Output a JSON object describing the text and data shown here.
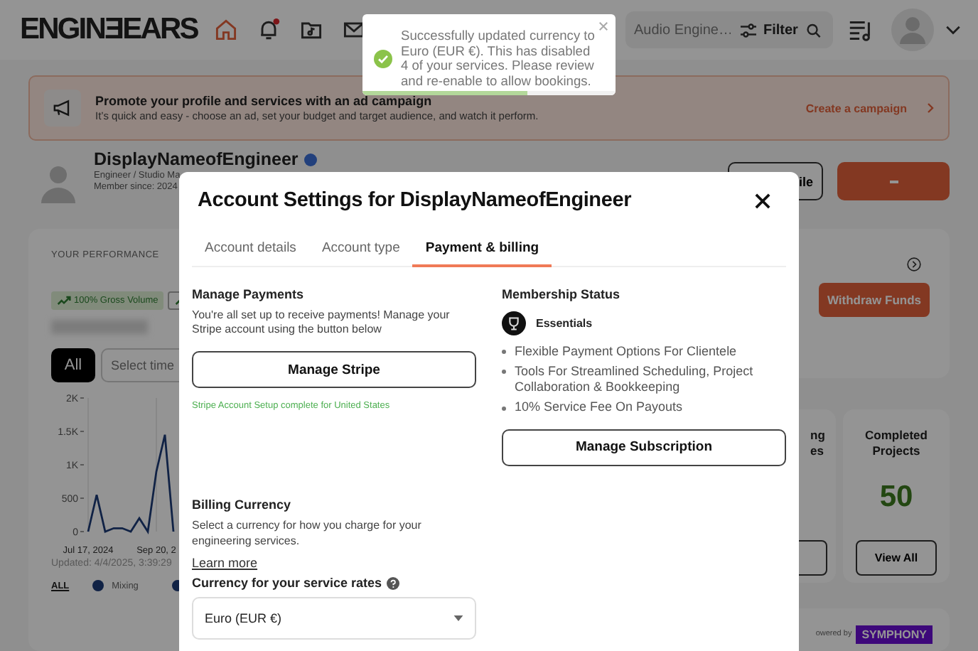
{
  "header": {
    "logo": "ENGINƎEARS",
    "nav": [
      {
        "kind": "home",
        "selected": true,
        "dot": false
      },
      {
        "kind": "bell",
        "selected": false,
        "dot": true
      },
      {
        "kind": "folder",
        "selected": false,
        "dot": false
      },
      {
        "kind": "mail",
        "selected": false,
        "dot": false
      }
    ],
    "search": {
      "placeholder": "Audio Engine…"
    },
    "filter": "Filter"
  },
  "promo": {
    "title": "Promote your profile and services with an ad campaign",
    "text": "It’s quick and easy - choose an ad, set your budget and target audience, and watch it perform.",
    "link": "Create a campaign"
  },
  "profile": {
    "name": "DisplayNameofEngineer",
    "verified": true,
    "role": "Engineer / Studio Ma",
    "member": "Member since: 2024",
    "edit_button": "ile"
  },
  "performance": {
    "heading": "YOUR PERFORMANCE",
    "badge": "100% Gross Volume",
    "all": "All",
    "select": "Select time",
    "chart_data": {
      "type": "line",
      "categories": [
        "Jul 17, 2024",
        null,
        null,
        null,
        null,
        null,
        null,
        null,
        "Sep 20, 2",
        null,
        null
      ],
      "series": [
        {
          "color": "#1d3b78",
          "values": [
            0,
            550,
            0,
            50,
            50,
            0,
            200,
            0,
            900,
            1450,
            0
          ]
        }
      ],
      "ylim": [
        0,
        2000
      ],
      "yticks": [
        {
          "value": 0,
          "label": "0"
        },
        {
          "value": 500,
          "label": "500"
        },
        {
          "value": 1000,
          "label": "1K"
        },
        {
          "value": 1500,
          "label": "1.5K"
        },
        {
          "value": 2000,
          "label": "2K"
        }
      ]
    },
    "updated": "Updated: 4/4/2025, 3:39:29",
    "legend": {
      "all": "ALL",
      "items": [
        "Mixing"
      ]
    }
  },
  "wallet": {
    "button": "Withdraw Funds"
  },
  "stats": [
    {
      "title": "ng es"
    },
    {
      "title": "Completed Projects",
      "value": "50",
      "button": "View All"
    }
  ],
  "footer": {
    "powered": "owered by",
    "brand": "SYMPHONY"
  },
  "toast": {
    "message": "Successfully updated currency to Euro (EUR €). This has disabled 4 of your services. Please review and re-enable to allow bookings.",
    "level": 0.65
  },
  "modal": {
    "title": "Account Settings for DisplayNameofEngineer",
    "tabs": [
      {
        "label": "Account details",
        "selected": false
      },
      {
        "label": "Account type",
        "selected": false
      },
      {
        "label": "Payment & billing",
        "selected": true
      }
    ],
    "payments": {
      "heading": "Manage Payments",
      "text": "You're all set up to receive payments! Manage your Stripe account using the button below",
      "button": "Manage Stripe",
      "status": "Stripe Account Setup complete for United States"
    },
    "billing": {
      "heading": "Billing Currency",
      "text": "Select a currency for how you charge for your engineering services.",
      "link": "Learn more",
      "label": "Currency for your service rates",
      "value": "Euro (EUR €)"
    },
    "membership": {
      "heading": "Membership Status",
      "plan": "Essentials",
      "features": [
        "Flexible Payment Options For Clientele",
        "Tools For Streamlined Scheduling, Project Collaboration & Bookkeeping",
        "10% Service Fee On Payouts"
      ],
      "button": "Manage Subscription"
    }
  }
}
